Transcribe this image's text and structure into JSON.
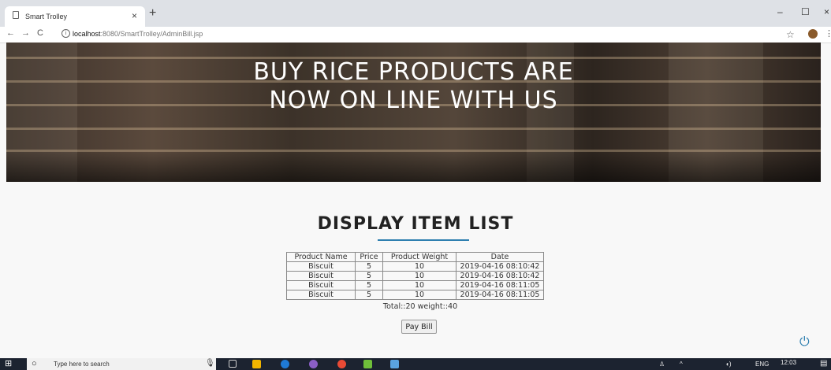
{
  "browser": {
    "tab_title": "Smart Trolley",
    "tab_close": "×",
    "new_tab": "+",
    "url_host": "localhost",
    "url_path": ":8080/SmartTrolley/AdminBill.jsp",
    "min": "–",
    "max": "☐",
    "close": "×"
  },
  "hero": {
    "line1": "BUY RICE PRODUCTS ARE",
    "line2": "NOW ON LINE WITH US"
  },
  "section": {
    "title": "DISPLAY ITEM LIST"
  },
  "table": {
    "headers": [
      "Product Name",
      "Price",
      "Product Weight",
      "Date"
    ],
    "rows": [
      [
        "Biscuit",
        "5",
        "10",
        "2019-04-16 08:10:42"
      ],
      [
        "Biscuit",
        "5",
        "10",
        "2019-04-16 08:10:42"
      ],
      [
        "Biscuit",
        "5",
        "10",
        "2019-04-16 08:11:05"
      ],
      [
        "Biscuit",
        "5",
        "10",
        "2019-04-16 08:11:05"
      ]
    ]
  },
  "summary": {
    "total_text": "Total::20 weight::40"
  },
  "actions": {
    "pay_label": "Pay Bill"
  },
  "taskbar": {
    "search_placeholder": "Type here to search",
    "language": "ENG",
    "time": "12:03"
  },
  "colors": {
    "accent": "#2e7fb0",
    "taskbar": "#1c2330"
  }
}
